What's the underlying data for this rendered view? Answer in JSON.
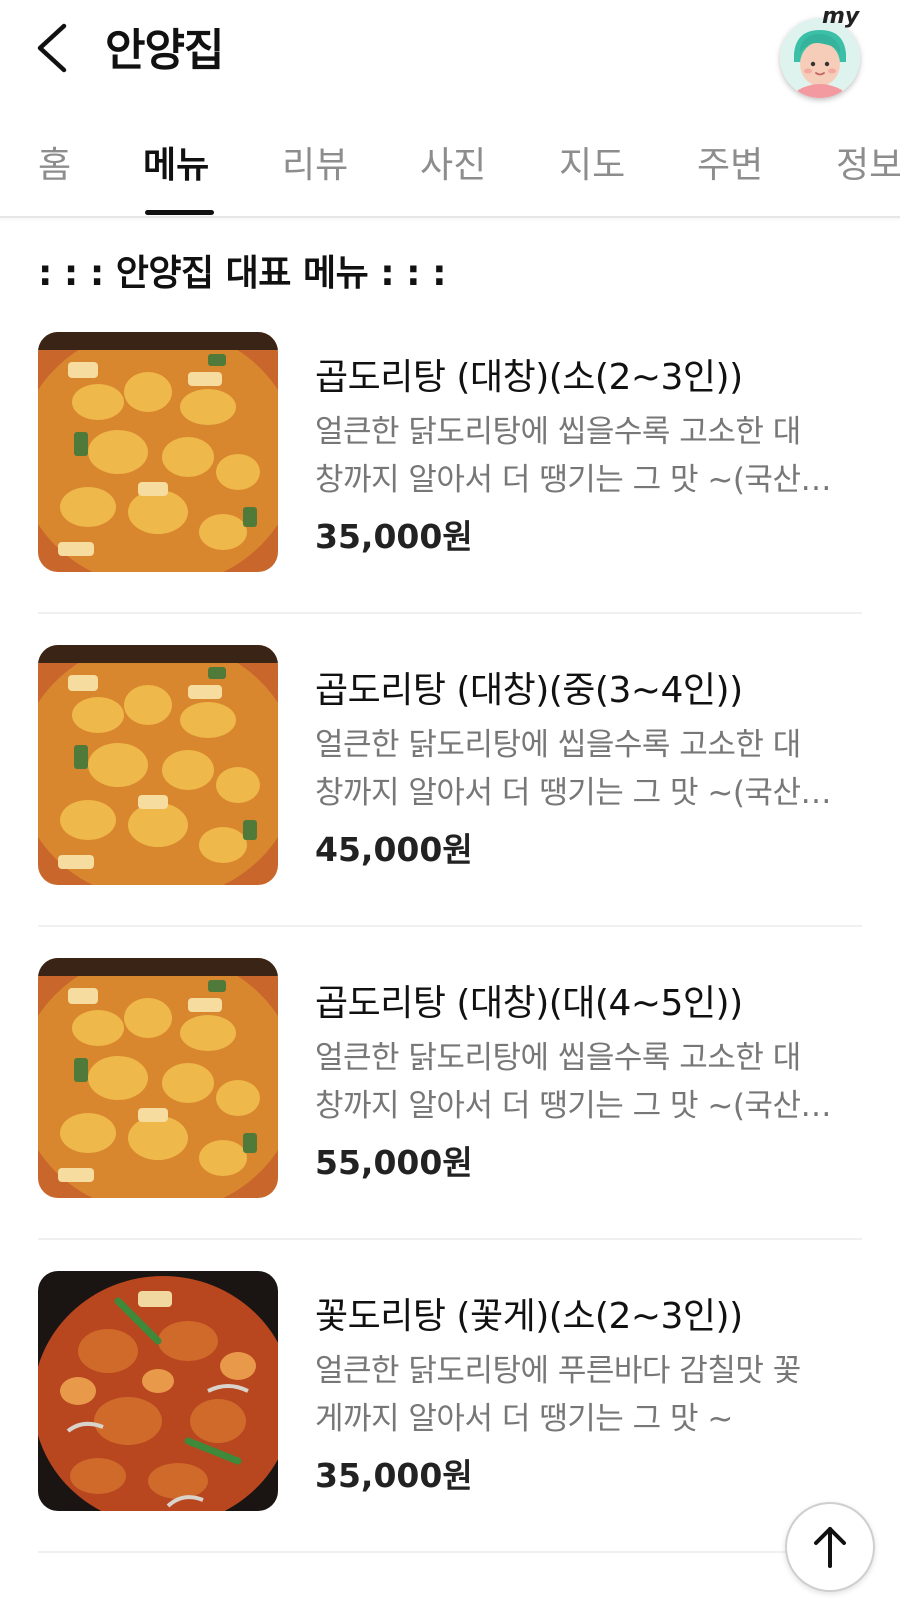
{
  "header": {
    "title": "안양집",
    "avatar_label": "my",
    "back_icon": "chevron-left-icon"
  },
  "tabs": [
    {
      "label": "홈",
      "active": false
    },
    {
      "label": "메뉴",
      "active": true
    },
    {
      "label": "리뷰",
      "active": false
    },
    {
      "label": "사진",
      "active": false
    },
    {
      "label": "지도",
      "active": false
    },
    {
      "label": "주변",
      "active": false
    },
    {
      "label": "정보",
      "active": false
    }
  ],
  "section": {
    "title": ": : : 안양집 대표 메뉴 : : :"
  },
  "menu_items": [
    {
      "name": "곱도리탕 (대창)(소(2~3인))",
      "desc_line1": "얼큰한 닭도리탕에 씹을수록 고소한 대",
      "desc_line2": "창까지 알아서 더 땡기는 그 맛 ~(국산…",
      "price": "35,000원"
    },
    {
      "name": "곱도리탕 (대창)(중(3~4인))",
      "desc_line1": "얼큰한 닭도리탕에 씹을수록 고소한 대",
      "desc_line2": "창까지 알아서 더 땡기는 그 맛 ~(국산…",
      "price": "45,000원"
    },
    {
      "name": "곱도리탕 (대창)(대(4~5인))",
      "desc_line1": "얼큰한 닭도리탕에 씹을수록 고소한 대",
      "desc_line2": "창까지 알아서 더 땡기는 그 맛 ~(국산…",
      "price": "55,000원"
    },
    {
      "name": "꽃도리탕 (꽃게)(소(2~3인))",
      "desc_line1": "얼큰한 닭도리탕에 푸른바다 감칠맛 꽃",
      "desc_line2": "게까지 알아서 더 땡기는 그 맛 ~",
      "price": "35,000원"
    }
  ],
  "scroll_top_icon": "arrow-up-icon",
  "colors": {
    "text_primary": "#111111",
    "text_secondary": "#777777",
    "tab_inactive": "#8d8d8d",
    "divider": "#f0f0f0"
  }
}
